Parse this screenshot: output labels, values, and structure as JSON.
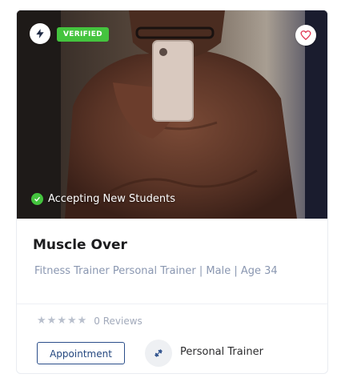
{
  "card": {
    "verified_label": "VERIFIED",
    "accepting_label": "Accepting New Students",
    "name": "Muscle Over",
    "subtitle": "Fitness Trainer Personal Trainer | Male | Age 34",
    "rating": {
      "stars": 0,
      "max": 5,
      "reviews_label": "0 Reviews"
    },
    "appointment_label": "Appointment",
    "trainer_type": "Personal Trainer",
    "icons": {
      "badge": "lightning-bolt-icon",
      "favorite": "heart-icon",
      "status": "check-circle-icon",
      "type": "dumbbell-icon"
    }
  },
  "colors": {
    "verified": "#44c43e",
    "favorite": "#e0334f",
    "button_border": "#2a4e8a",
    "subtitle": "#8a97b1"
  }
}
